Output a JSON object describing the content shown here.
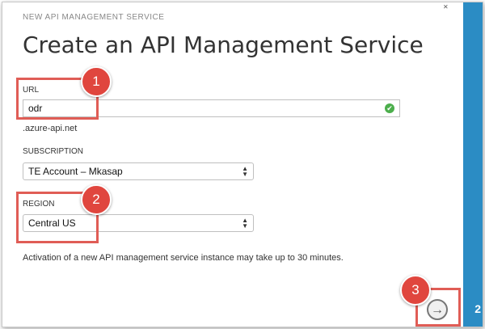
{
  "dialog": {
    "header": "NEW API MANAGEMENT SERVICE",
    "title": "Create an API Management Service",
    "close_icon": "˟",
    "side_number": "2"
  },
  "url": {
    "label": "URL",
    "value": "odr",
    "suffix": ".azure-api.net",
    "status_icon": "✔"
  },
  "subscription": {
    "label": "SUBSCRIPTION",
    "value": "TE Account – Mkasap"
  },
  "region": {
    "label": "REGION",
    "value": "Central US"
  },
  "note": "Activation of a new API management service instance may take up to 30 minutes.",
  "next_icon": "→",
  "annotations": [
    "1",
    "2",
    "3"
  ],
  "colors": {
    "accent": "#2b8cc4",
    "highlight": "#e05d56",
    "badge": "#e0463e",
    "ok": "#4cae4c"
  }
}
